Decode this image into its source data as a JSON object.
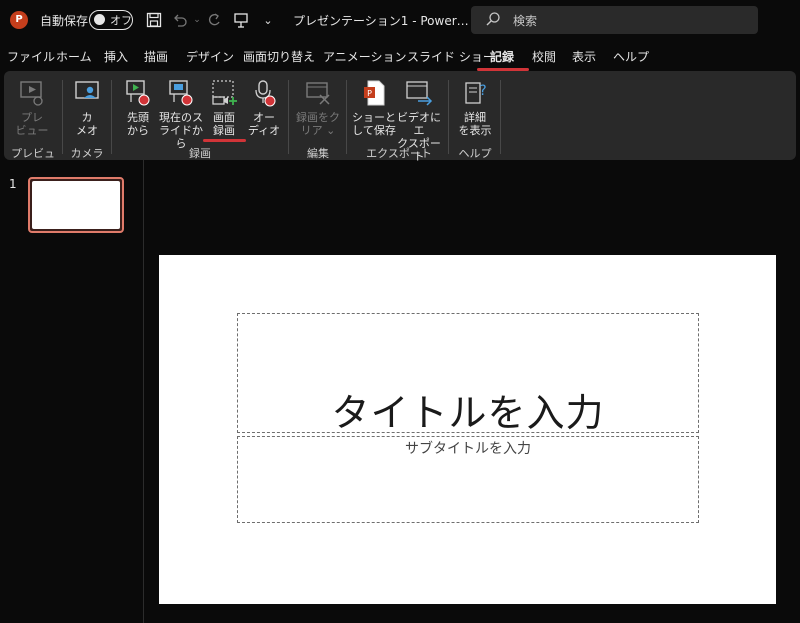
{
  "titlebar": {
    "app_icon": "powerpoint-icon",
    "app_icon_letter": "P",
    "autosave_label": "自動保存",
    "autosave_state": "オフ",
    "doc_title": "プレゼンテーション1  -  Power…",
    "search_placeholder": "検索"
  },
  "tabs": [
    {
      "label": "ファイル"
    },
    {
      "label": "ホーム"
    },
    {
      "label": "挿入"
    },
    {
      "label": "描画"
    },
    {
      "label": "デザイン"
    },
    {
      "label": "画面切り替え"
    },
    {
      "label": "アニメーション"
    },
    {
      "label": "スライド ショー"
    },
    {
      "label": "記録",
      "active": true
    },
    {
      "label": "校閲"
    },
    {
      "label": "表示"
    },
    {
      "label": "ヘルプ"
    }
  ],
  "ribbon": {
    "preview": {
      "line1": "プレ",
      "line2": "ビュー",
      "group": "プレビュー"
    },
    "camera": {
      "line1": "カ",
      "line2": "メオ",
      "group": "カメラ"
    },
    "from_start": {
      "line1": "先頭",
      "line2": "から"
    },
    "from_current": {
      "line1": "現在のス",
      "line2": "ライドから"
    },
    "screen_rec": {
      "line1": "画面",
      "line2": "録画"
    },
    "audio": {
      "line1": "オー",
      "line2": "ディオ"
    },
    "record_group": "録画",
    "clear_rec": {
      "line1": "録画をク",
      "line2": "リア ⌄"
    },
    "edit_group": "編集",
    "save_as_show": {
      "line1": "ショーと",
      "line2": "して保存"
    },
    "export_video": {
      "line1": "ビデオにエ",
      "line2": "クスポート"
    },
    "export_group": "エクスポート",
    "details": {
      "line1": "詳細",
      "line2": "を表示"
    },
    "help_group": "ヘルプ"
  },
  "thumbnails": {
    "slide_number": "1"
  },
  "slide": {
    "title_placeholder": "タイトルを入力",
    "subtitle_placeholder": "サブタイトルを入力"
  },
  "colors": {
    "accent": "#d13438",
    "thumb_border": "#e07b6a",
    "ribbon_bg": "#292929"
  }
}
